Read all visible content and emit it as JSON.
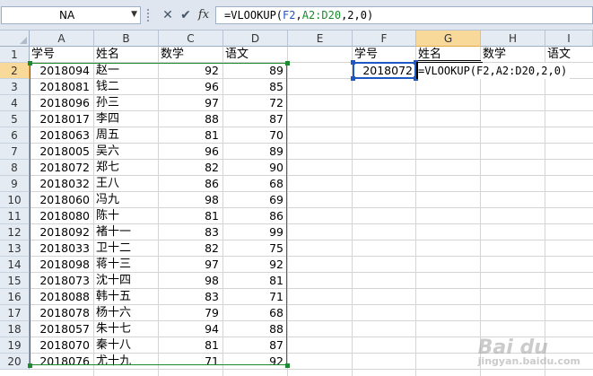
{
  "formula_bar": {
    "name_box": "NA",
    "cancel_icon": "✕",
    "enter_icon": "✔",
    "fx_label": "fx",
    "formula_prefix": "=VLOOKUP(",
    "formula_ref1": "F2",
    "formula_comma1": ",",
    "formula_ref2": "A2:D20",
    "formula_suffix": ",2,0)"
  },
  "columns": [
    "A",
    "B",
    "C",
    "D",
    "E",
    "F",
    "G",
    "H",
    "I"
  ],
  "rows": [
    "1",
    "2",
    "3",
    "4",
    "5",
    "6",
    "7",
    "8",
    "9",
    "10",
    "11",
    "12",
    "13",
    "14",
    "15",
    "16",
    "17",
    "18",
    "19",
    "20"
  ],
  "headers": {
    "id": "学号",
    "name": "姓名",
    "math": "数学",
    "chinese": "语文"
  },
  "table": [
    {
      "id": "2018094",
      "name": "赵一",
      "math": "92",
      "chinese": "89"
    },
    {
      "id": "2018081",
      "name": "钱二",
      "math": "96",
      "chinese": "85"
    },
    {
      "id": "2018096",
      "name": "孙三",
      "math": "97",
      "chinese": "72"
    },
    {
      "id": "2018017",
      "name": "李四",
      "math": "88",
      "chinese": "87"
    },
    {
      "id": "2018063",
      "name": "周五",
      "math": "81",
      "chinese": "70"
    },
    {
      "id": "2018005",
      "name": "吴六",
      "math": "96",
      "chinese": "89"
    },
    {
      "id": "2018072",
      "name": "郑七",
      "math": "82",
      "chinese": "90"
    },
    {
      "id": "2018032",
      "name": "王八",
      "math": "86",
      "chinese": "68"
    },
    {
      "id": "2018060",
      "name": "冯九",
      "math": "98",
      "chinese": "69"
    },
    {
      "id": "2018080",
      "name": "陈十",
      "math": "81",
      "chinese": "86"
    },
    {
      "id": "2018092",
      "name": "褚十一",
      "math": "83",
      "chinese": "99"
    },
    {
      "id": "2018033",
      "name": "卫十二",
      "math": "82",
      "chinese": "75"
    },
    {
      "id": "2018098",
      "name": "蒋十三",
      "math": "97",
      "chinese": "92"
    },
    {
      "id": "2018073",
      "name": "沈十四",
      "math": "98",
      "chinese": "81"
    },
    {
      "id": "2018088",
      "name": "韩十五",
      "math": "83",
      "chinese": "71"
    },
    {
      "id": "2018078",
      "name": "杨十六",
      "math": "79",
      "chinese": "68"
    },
    {
      "id": "2018057",
      "name": "朱十七",
      "math": "94",
      "chinese": "88"
    },
    {
      "id": "2018070",
      "name": "秦十八",
      "math": "81",
      "chinese": "87"
    },
    {
      "id": "2018076",
      "name": "尤十九",
      "math": "71",
      "chinese": "92"
    }
  ],
  "lookup": {
    "h_id": "学号",
    "h_name": "姓名",
    "h_math": "数学",
    "h_chinese": "语文",
    "f2_value": "2018072",
    "g2_editing": "=VLOOKUP(F2,A2:D20,2,0)"
  },
  "watermark": {
    "brand": "Bai du",
    "sub": "jingyan.baidu.com"
  },
  "colors": {
    "range_green": "#1c8a2e",
    "ref_blue": "#1f57c3",
    "header_active": "#f9d99a"
  }
}
